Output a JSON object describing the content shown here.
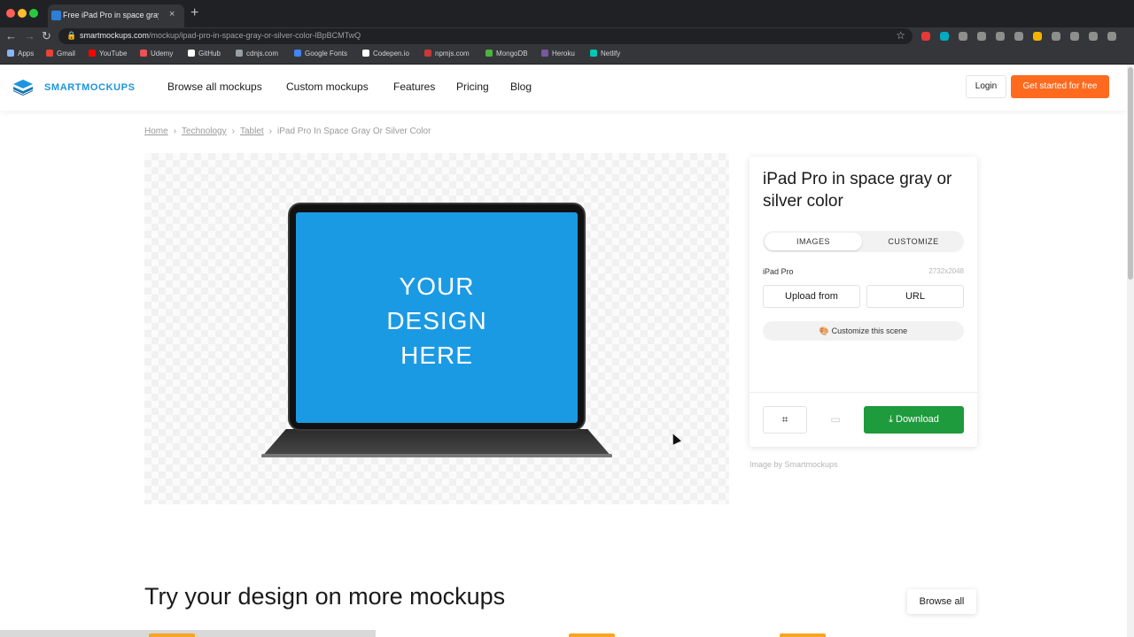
{
  "browser": {
    "tab_title": "Free iPad Pro in space gray or",
    "tab_close": "×",
    "new_tab": "+",
    "url_host": "smartmockups.com",
    "url_path": "/mockup/ipad-pro-in-space-gray-or-silver-color-lBpBCMTwQ",
    "lock_icon": "lock-icon",
    "bookmarks": [
      "Apps",
      "Gmail",
      "YouTube",
      "Udemy",
      "GitHub",
      "cdnjs.com",
      "Google Fonts",
      "Codepen.io",
      "npmjs.com",
      "MongoDB",
      "Heroku",
      "Netlify"
    ],
    "bookmark_colors": [
      "#8ab4f8",
      "#ea4335",
      "#ff0000",
      "#ec5252",
      "#ffffff",
      "#9aa0a6",
      "#4285f4",
      "#ffffff",
      "#cb3837",
      "#4db33d",
      "#79589f",
      "#00c7b7"
    ],
    "extension_colors": [
      "#e53935",
      "#00acc1",
      "#8e8e8e",
      "#8e8e8e",
      "#8e8e8e",
      "#8e8e8e",
      "#f4b400",
      "#8e8e8e",
      "#8e8e8e",
      "#8e8e8e",
      "#8e8e8e"
    ]
  },
  "header": {
    "logo": "SMARTMOCKUPS",
    "nav": [
      "Browse all mockups",
      "Custom mockups",
      "Features",
      "Pricing",
      "Blog"
    ],
    "login": "Login",
    "cta": "Get started for free",
    "accent": "#ff6a1f",
    "brand": "#1b95e0"
  },
  "breadcrumb": {
    "items": [
      "Home",
      "Technology",
      "Tablet"
    ],
    "current": "iPad Pro In Space Gray Or Silver Color",
    "separator": "›"
  },
  "preview": {
    "screen_text": "YOUR\nDESIGN\nHERE",
    "screen_color": "#1b9ae4"
  },
  "panel": {
    "title": "iPad Pro in space gray or silver color",
    "tabs": [
      "IMAGES",
      "CUSTOMIZE"
    ],
    "active_tab": "IMAGES",
    "device_label": "iPad Pro",
    "resolution": "2732x2048",
    "upload_label": "Upload from",
    "url_label": "URL",
    "customize_label": "🎨 Customize this scene",
    "crop_icon": "crop-icon",
    "save_icon": "save-icon",
    "download_label": "Download",
    "download_color": "#1e9b3c",
    "credit": "Image by Smartmockups"
  },
  "more": {
    "heading": "Try your design on more mockups",
    "browse_all": "Browse all"
  }
}
